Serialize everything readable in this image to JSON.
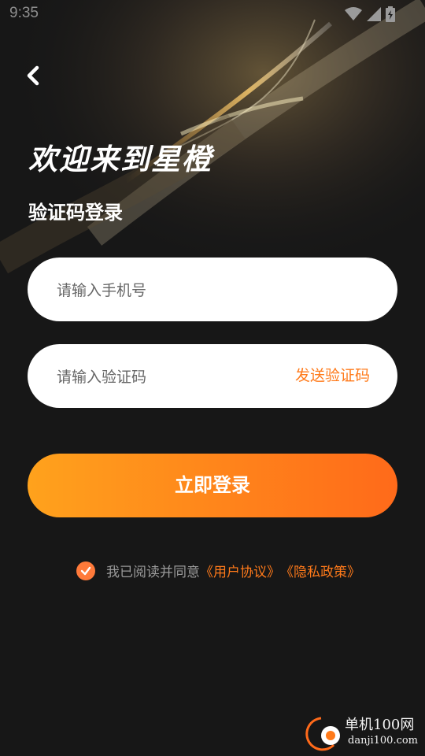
{
  "status_bar": {
    "time": "9:35",
    "icons": [
      "wifi-icon",
      "cell-signal-icon",
      "battery-icon"
    ]
  },
  "header": {
    "back_icon": "chevron-left-icon",
    "title": "欢迎来到星橙",
    "subtitle": "验证码登录"
  },
  "form": {
    "phone_placeholder": "请输入手机号",
    "code_placeholder": "请输入验证码",
    "send_code_label": "发送验证码",
    "login_label": "立即登录"
  },
  "agreement": {
    "checked": true,
    "prefix": "我已阅读并同意",
    "user_agreement": "《用户协议》",
    "privacy_policy": "《隐私政策》"
  },
  "watermark": {
    "text_cn": "单机100网",
    "text_en": "danji100.com"
  },
  "colors": {
    "background": "#171717",
    "accent": "#ff7a1a",
    "button_gradient_start": "#ffa21c",
    "button_gradient_end": "#ff6a1a",
    "field_bg": "#ffffff"
  }
}
